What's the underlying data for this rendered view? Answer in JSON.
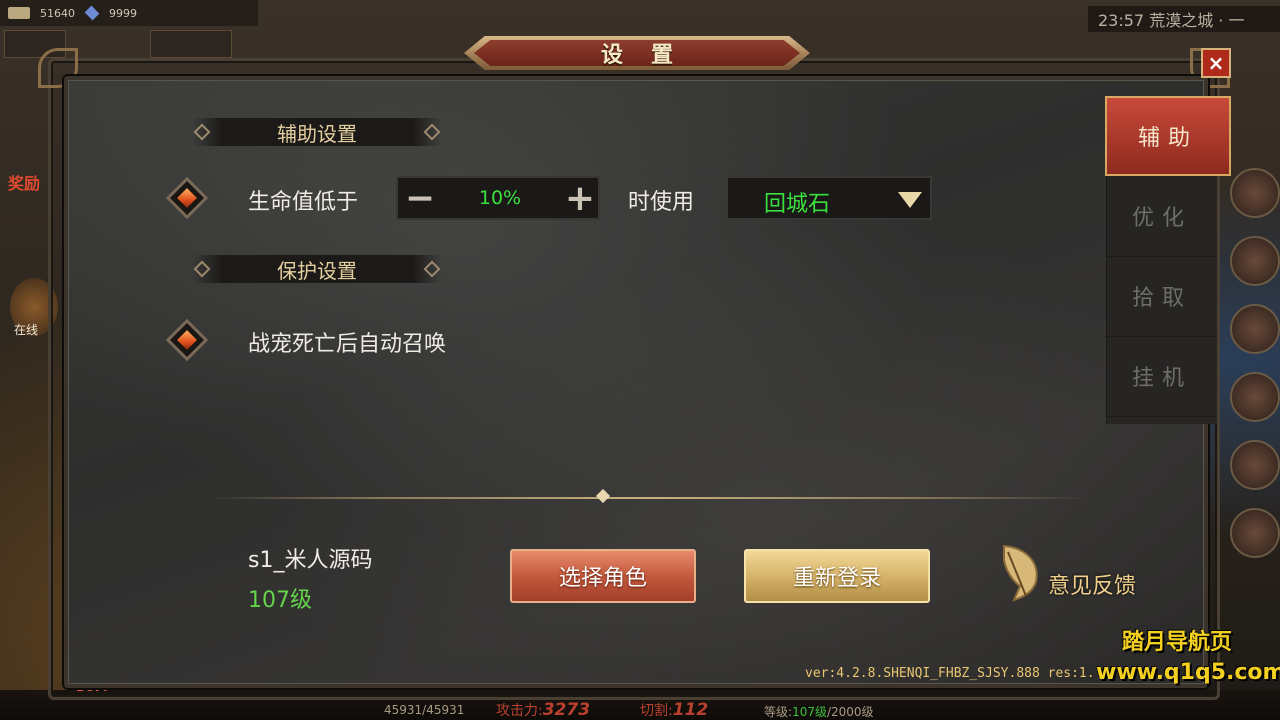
{
  "hud": {
    "gold": "51640",
    "gems": "9999",
    "clock": "23:57  荒漠之城 · 一",
    "reward_label": "奖励",
    "online_label": "在线",
    "buff_label": "BUFF",
    "hp": "45931/45931",
    "attack_label": "攻击力",
    "attack_value": "3273",
    "cut_label": "切割",
    "cut_value": "112",
    "level_label": "等级",
    "level_value": "107级",
    "level_max": "/2000级"
  },
  "dialog": {
    "title": "设置",
    "close_label": "×",
    "tabs": [
      {
        "label": "辅助",
        "active": true
      },
      {
        "label": "优化",
        "active": false
      },
      {
        "label": "拾取",
        "active": false
      },
      {
        "label": "挂机",
        "active": false
      }
    ],
    "assist_header": "辅助设置",
    "hp_label": "生命值低于",
    "hp_value": "10%",
    "minus": "−",
    "plus": "+",
    "use_label": "时使用",
    "use_item": "回城石",
    "protect_header": "保护设置",
    "pet_revive_label": "战宠死亡后自动召唤",
    "player_name": "s1_米人源码",
    "player_level": "107级",
    "select_role_label": "选择角色",
    "relogin_label": "重新登录",
    "feedback_label": "意见反馈"
  },
  "version": "ver:4.2.8.SHENQI_FHBZ_SJSY.888 res:1.",
  "watermark": {
    "line1": "踏月导航页",
    "line2": "www.q1q5.com"
  }
}
